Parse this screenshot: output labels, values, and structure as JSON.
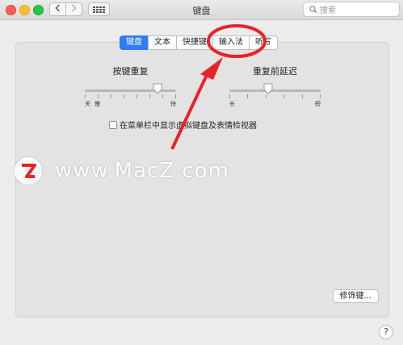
{
  "window": {
    "title": "键盘",
    "search_placeholder": "搜索"
  },
  "tabs": [
    {
      "label": "键盘",
      "active": true
    },
    {
      "label": "文本",
      "active": false
    },
    {
      "label": "快捷键",
      "active": false
    },
    {
      "label": "输入法",
      "active": false
    },
    {
      "label": "听写",
      "active": false
    }
  ],
  "key_repeat": {
    "title": "按键重复",
    "label_off": "关",
    "label_slow": "慢",
    "label_fast": "快",
    "value_fraction": 0.83
  },
  "delay_until_repeat": {
    "title": "重复前延迟",
    "label_long": "长",
    "label_short": "短",
    "value_fraction": 0.42
  },
  "checkbox": {
    "label": "在菜单栏中显示虚拟键盘及表情检视器",
    "checked": false
  },
  "buttons": {
    "modifier_keys": "修饰键…",
    "help": "?"
  },
  "watermark": {
    "text": "www.MacZ.com"
  },
  "colors": {
    "accent": "#2f7cf6",
    "annotation_red": "#e8232a"
  }
}
